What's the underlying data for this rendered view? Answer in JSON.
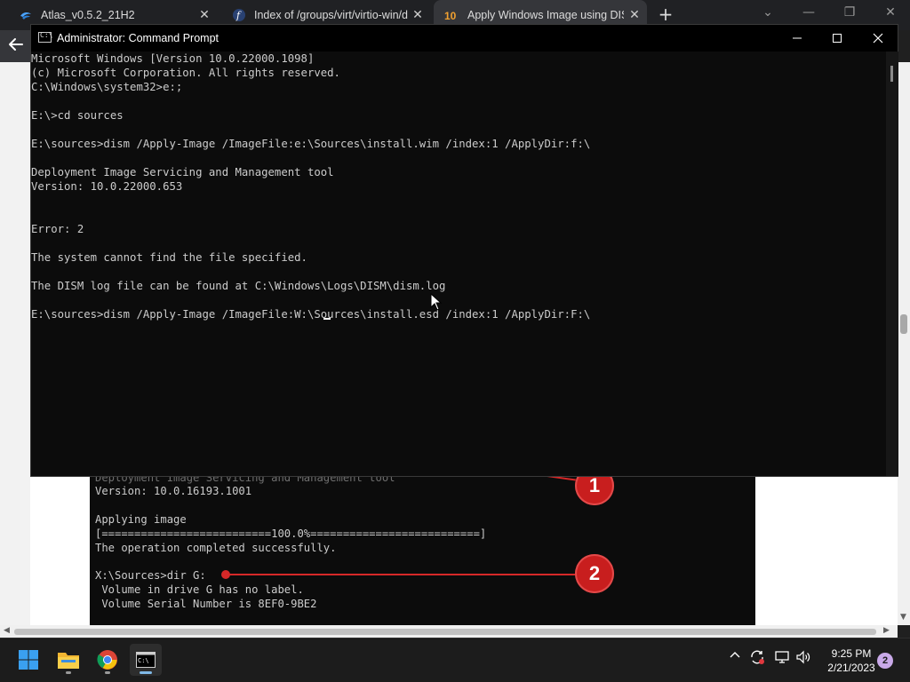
{
  "browser": {
    "tabs": [
      {
        "title": "Atlas_v0.5.2_21H2",
        "icon": "atlas-icon"
      },
      {
        "title": "Index of /groups/virt/virtio-win/d",
        "icon": "fedora-icon"
      },
      {
        "title": "Apply Windows Image using DISM",
        "icon": "windows10-icon"
      }
    ],
    "active_tab": 2
  },
  "cmd_window": {
    "title": "Administrator: Command Prompt",
    "lines": [
      "Microsoft Windows [Version 10.0.22000.1098]",
      "(c) Microsoft Corporation. All rights reserved.",
      "C:\\Windows\\system32>e:;",
      "",
      "E:\\>cd sources",
      "",
      "E:\\sources>dism /Apply-Image /ImageFile:e:\\Sources\\install.wim /index:1 /ApplyDir:f:\\",
      "",
      "Deployment Image Servicing and Management tool",
      "Version: 10.0.22000.653",
      "",
      "",
      "Error: 2",
      "",
      "The system cannot find the file specified.",
      "",
      "The DISM log file can be found at C:\\Windows\\Logs\\DISM\\dism.log",
      "",
      "E:\\sources>dism /Apply-Image /ImageFile:W:\\Sources\\install.esd /index:1 /ApplyDir:F:\\"
    ]
  },
  "background_page": {
    "screenshot_lines": [
      "Deployment Image Servicing and Management tool",
      "Version: 10.0.16193.1001",
      "",
      "Applying image",
      "[==========================100.0%==========================]",
      "The operation completed successfully.",
      "",
      "X:\\Sources>dir G:",
      " Volume in drive G has no label.",
      " Volume Serial Number is 8EF0-9BE2"
    ],
    "markers": [
      "1",
      "2"
    ]
  },
  "taskbar": {
    "apps": [
      "windows-start-icon",
      "file-explorer-icon",
      "chrome-icon",
      "terminal-icon"
    ],
    "time": "9:25 PM",
    "date": "2/21/2023",
    "notification_count": "2"
  }
}
